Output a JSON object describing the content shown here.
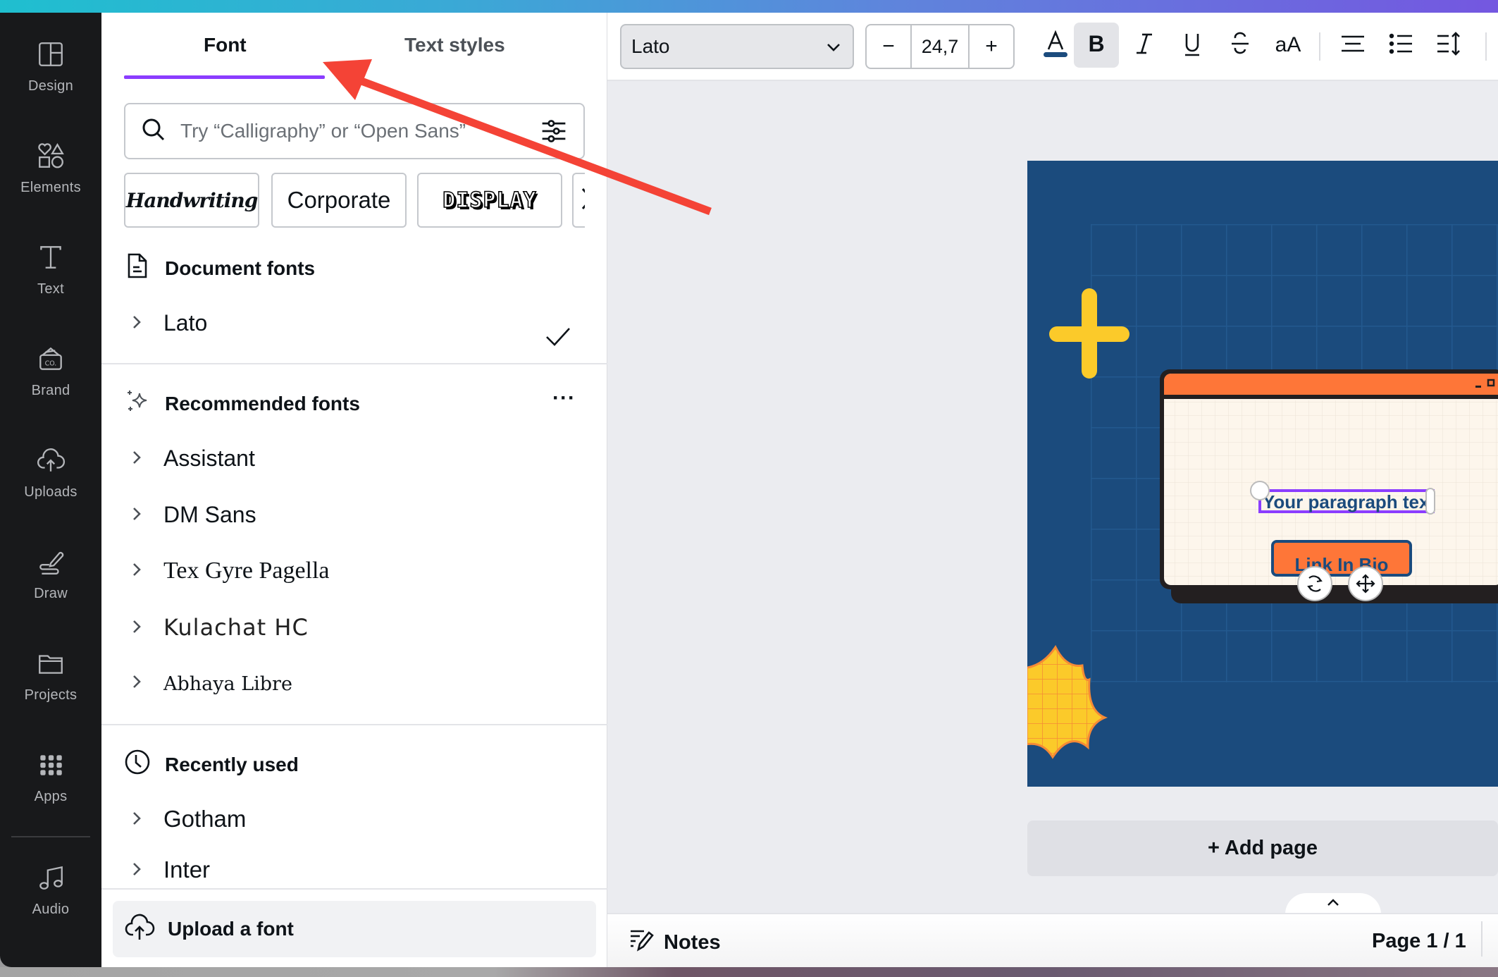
{
  "sidebar": {
    "items": [
      {
        "id": "design",
        "label": "Design",
        "icon": "layout-icon"
      },
      {
        "id": "elements",
        "label": "Elements",
        "icon": "shapes-icon"
      },
      {
        "id": "text",
        "label": "Text",
        "icon": "text-icon"
      },
      {
        "id": "brand",
        "label": "Brand",
        "icon": "brand-kit-icon"
      },
      {
        "id": "uploads",
        "label": "Uploads",
        "icon": "cloud-upload-icon"
      },
      {
        "id": "draw",
        "label": "Draw",
        "icon": "draw-icon"
      },
      {
        "id": "projects",
        "label": "Projects",
        "icon": "folder-icon"
      },
      {
        "id": "apps",
        "label": "Apps",
        "icon": "apps-grid-icon"
      },
      {
        "id": "audio",
        "label": "Audio",
        "icon": "music-note-icon"
      }
    ]
  },
  "panel": {
    "tabs": [
      {
        "label": "Font",
        "active": true
      },
      {
        "label": "Text styles",
        "active": false
      }
    ],
    "search": {
      "placeholder": "Try “Calligraphy” or “Open Sans”",
      "value": ""
    },
    "chips": [
      "Handwriting",
      "Corporate",
      "DISPLAY"
    ],
    "sections": {
      "document": {
        "title": "Document fonts",
        "fonts": [
          {
            "name": "Lato",
            "selected": true
          }
        ]
      },
      "recommended": {
        "title": "Recommended fonts",
        "more": "···",
        "fonts": [
          {
            "name": "Assistant"
          },
          {
            "name": "DM Sans"
          },
          {
            "name": "Tex Gyre Pagella"
          },
          {
            "name": "Kulachat HC"
          },
          {
            "name": "Abhaya Libre"
          }
        ]
      },
      "recent": {
        "title": "Recently used",
        "fonts": [
          {
            "name": "Gotham"
          },
          {
            "name": "Inter"
          }
        ]
      }
    },
    "upload_label": "Upload a font"
  },
  "toolbar": {
    "font_family": "Lato",
    "font_size": "24,7",
    "decrease_label": "−",
    "increase_label": "+",
    "text_color": "#1b4b7d",
    "case_label": "aA",
    "bold_active": true
  },
  "canvas": {
    "paragraph_text": "Your paragraph text",
    "button_text": "Link In Bio",
    "colors": {
      "background": "#1b4b7d",
      "window_bar": "#fe7638",
      "window_body": "#fdf6ec",
      "accent_yellow": "#fbca2a",
      "selection": "#8b3dff"
    },
    "add_page_label": "+ Add page"
  },
  "bottombar": {
    "notes_label": "Notes",
    "page_label": "Page 1 / 1"
  },
  "annotation": {
    "type": "red-arrow",
    "color": "#f44336",
    "points_to": "Font tab"
  }
}
